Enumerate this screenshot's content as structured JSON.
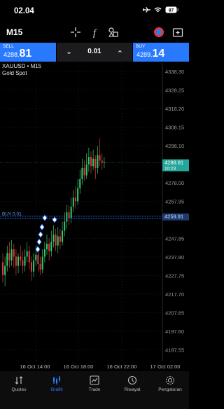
{
  "status_bar": {
    "time": "02.04"
  },
  "toolbar": {
    "timeframe": "M15"
  },
  "trade_panel": {
    "sell_label": "SELL",
    "sell_price_small": "4288.",
    "sell_price_big": "81",
    "lot": "0.01",
    "buy_label": "BUY",
    "buy_price_small": "4289.",
    "buy_price_big": "14"
  },
  "chart_info": {
    "symbol_line": "XAUUSD • M15",
    "name": "Gold Spot"
  },
  "price_axis": [
    "4338.30",
    "4328.25",
    "4318.20",
    "4308.15",
    "4298.10",
    "4278.00",
    "4267.95",
    "4247.85",
    "4237.80",
    "4227.75",
    "4217.70",
    "4207.65",
    "4197.60",
    "4187.55"
  ],
  "current_price_tag": {
    "price": "4288.81",
    "time": "10:23"
  },
  "order_tag": "4259.91",
  "buy_line_label": "BUY 0.01",
  "time_axis": [
    "16 Oct 14:00",
    "16 Oct 18:00",
    "16 Oct 22:00",
    "17 Oct 02:00"
  ],
  "nav": [
    {
      "label": "Quotes",
      "icon": "quotes-icon"
    },
    {
      "label": "Grafik",
      "icon": "chart-icon"
    },
    {
      "label": "Trade",
      "icon": "trade-icon"
    },
    {
      "label": "Riwayat",
      "icon": "history-icon"
    },
    {
      "label": "Pengaturan",
      "icon": "settings-icon"
    }
  ],
  "colors": {
    "accent": "#2979ff",
    "bull": "#2ecc71",
    "bear": "#e53935",
    "grid": "#1e3a3a"
  }
}
